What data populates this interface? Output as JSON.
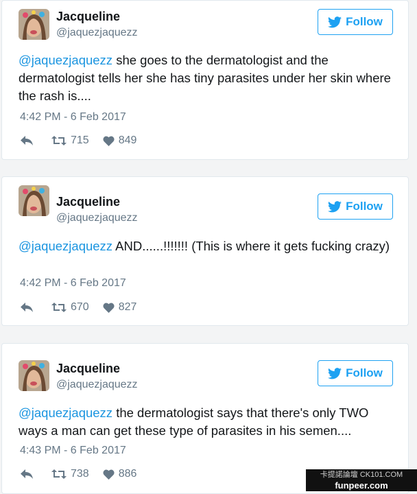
{
  "tweets": [
    {
      "name": "Jacqueline",
      "handle": "@jaquezjaquezz",
      "follow_label": "Follow",
      "mention": "@jaquezjaquezz",
      "text": " she goes to the dermatologist and the dermatologist tells her she has tiny parasites under her skin where the rash is....",
      "timestamp": "4:42 PM - 6 Feb 2017",
      "retweets": "715",
      "likes": "849"
    },
    {
      "name": "Jacqueline",
      "handle": "@jaquezjaquezz",
      "follow_label": "Follow",
      "mention": "@jaquezjaquezz",
      "text": " AND......!!!!!!! (This is where it gets fucking crazy)",
      "timestamp": "4:42 PM - 6 Feb 2017",
      "retweets": "670",
      "likes": "827"
    },
    {
      "name": "Jacqueline",
      "handle": "@jaquezjaquezz",
      "follow_label": "Follow",
      "mention": "@jaquezjaquezz",
      "text": " the dermatologist says that there's only TWO ways a man can get these type of parasites in his semen....",
      "timestamp": "4:43 PM - 6 Feb 2017",
      "retweets": "738",
      "likes": "886"
    }
  ],
  "watermark": {
    "top": "卡提諾論壇 CK101.COM",
    "bottom": "funpeer.com"
  },
  "colors": {
    "link": "#1b95e0",
    "follow": "#1da1f2",
    "meta": "#657786",
    "text": "#14171a"
  }
}
